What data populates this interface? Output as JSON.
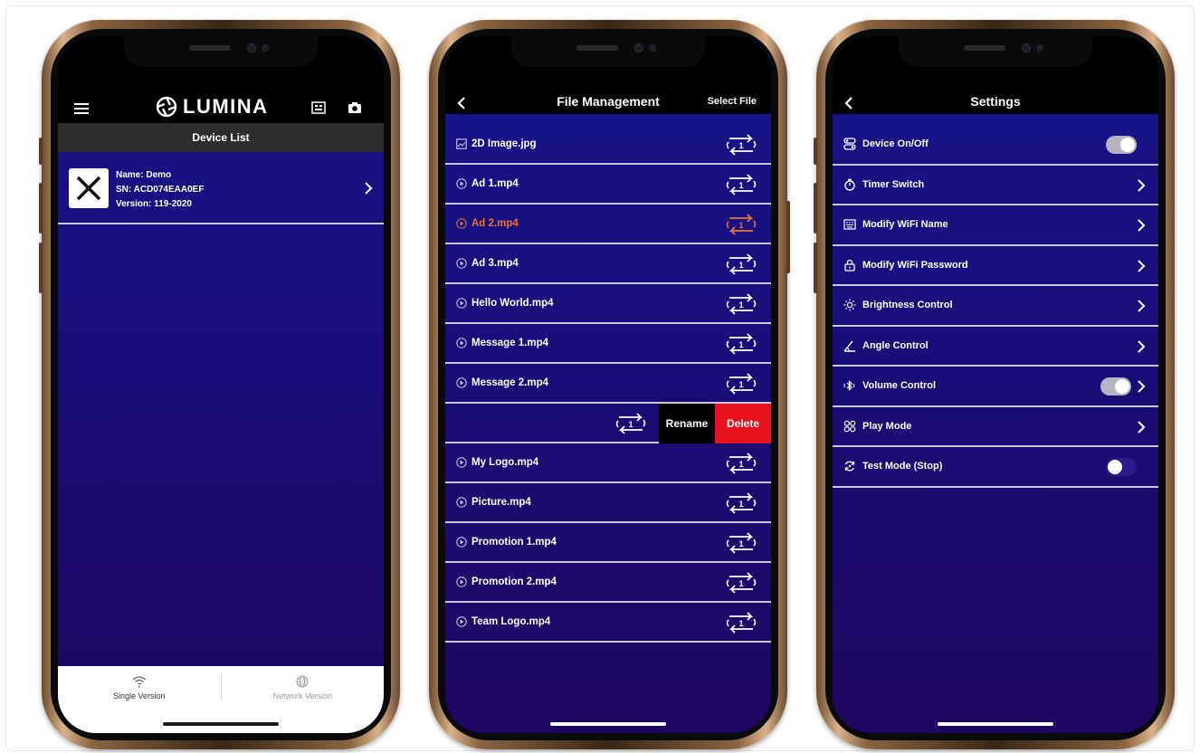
{
  "phone1": {
    "brand": "LUMINA",
    "subtitle": "Device List",
    "device": {
      "name_line": "Name: Demo",
      "sn_line": "SN: ACD074EAA0EF",
      "version_line": "Version: 119-2020"
    },
    "tabs": [
      {
        "label": "Single Version",
        "icon": "wifi-icon",
        "active": true
      },
      {
        "label": "Network Version",
        "icon": "globe-icon",
        "active": false
      }
    ]
  },
  "phone2": {
    "title": "File Management",
    "action": "Select File",
    "files": [
      {
        "name": "2D Image.jpg",
        "icon": "image-icon"
      },
      {
        "name": "Ad 1.mp4",
        "icon": "play-icon"
      },
      {
        "name": "Ad 2.mp4",
        "icon": "play-icon",
        "highlight": true
      },
      {
        "name": "Ad 3.mp4",
        "icon": "play-icon"
      },
      {
        "name": "Hello World.mp4",
        "icon": "play-icon"
      },
      {
        "name": "Message 1.mp4",
        "icon": "play-icon"
      },
      {
        "name": "Message 2.mp4",
        "icon": "play-icon"
      }
    ],
    "swipe_actions": {
      "rename": "Rename",
      "delete": "Delete"
    },
    "files_after": [
      {
        "name": "My Logo.mp4",
        "icon": "play-icon"
      },
      {
        "name": "Picture.mp4",
        "icon": "play-icon"
      },
      {
        "name": "Promotion 1.mp4",
        "icon": "play-icon"
      },
      {
        "name": "Promotion 2.mp4",
        "icon": "play-icon"
      },
      {
        "name": "Team Logo.mp4",
        "icon": "play-icon"
      }
    ],
    "loop_count": "1",
    "colors": {
      "highlight": "#e8743a",
      "delete": "#e8121c"
    }
  },
  "phone3": {
    "title": "Settings",
    "items": [
      {
        "label": "Device On/Off",
        "icon": "power-switch-icon",
        "control": "toggle",
        "on": true
      },
      {
        "label": "Timer Switch",
        "icon": "stopwatch-icon",
        "control": "chevron"
      },
      {
        "label": "Modify WiFi Name",
        "icon": "keyboard-icon",
        "control": "chevron"
      },
      {
        "label": "Modify WiFi Password",
        "icon": "lock-icon",
        "control": "chevron"
      },
      {
        "label": "Brightness Control",
        "icon": "sun-icon",
        "control": "chevron"
      },
      {
        "label": "Angle Control",
        "icon": "angle-icon",
        "control": "chevron"
      },
      {
        "label": "Volume Control",
        "icon": "bluetooth-audio-icon",
        "control": "toggle-chevron",
        "on": true
      },
      {
        "label": "Play Mode",
        "icon": "grid-icon",
        "control": "chevron"
      },
      {
        "label": "Test Mode (Stop)",
        "icon": "refresh-icon",
        "control": "toggle",
        "on": false
      }
    ]
  }
}
